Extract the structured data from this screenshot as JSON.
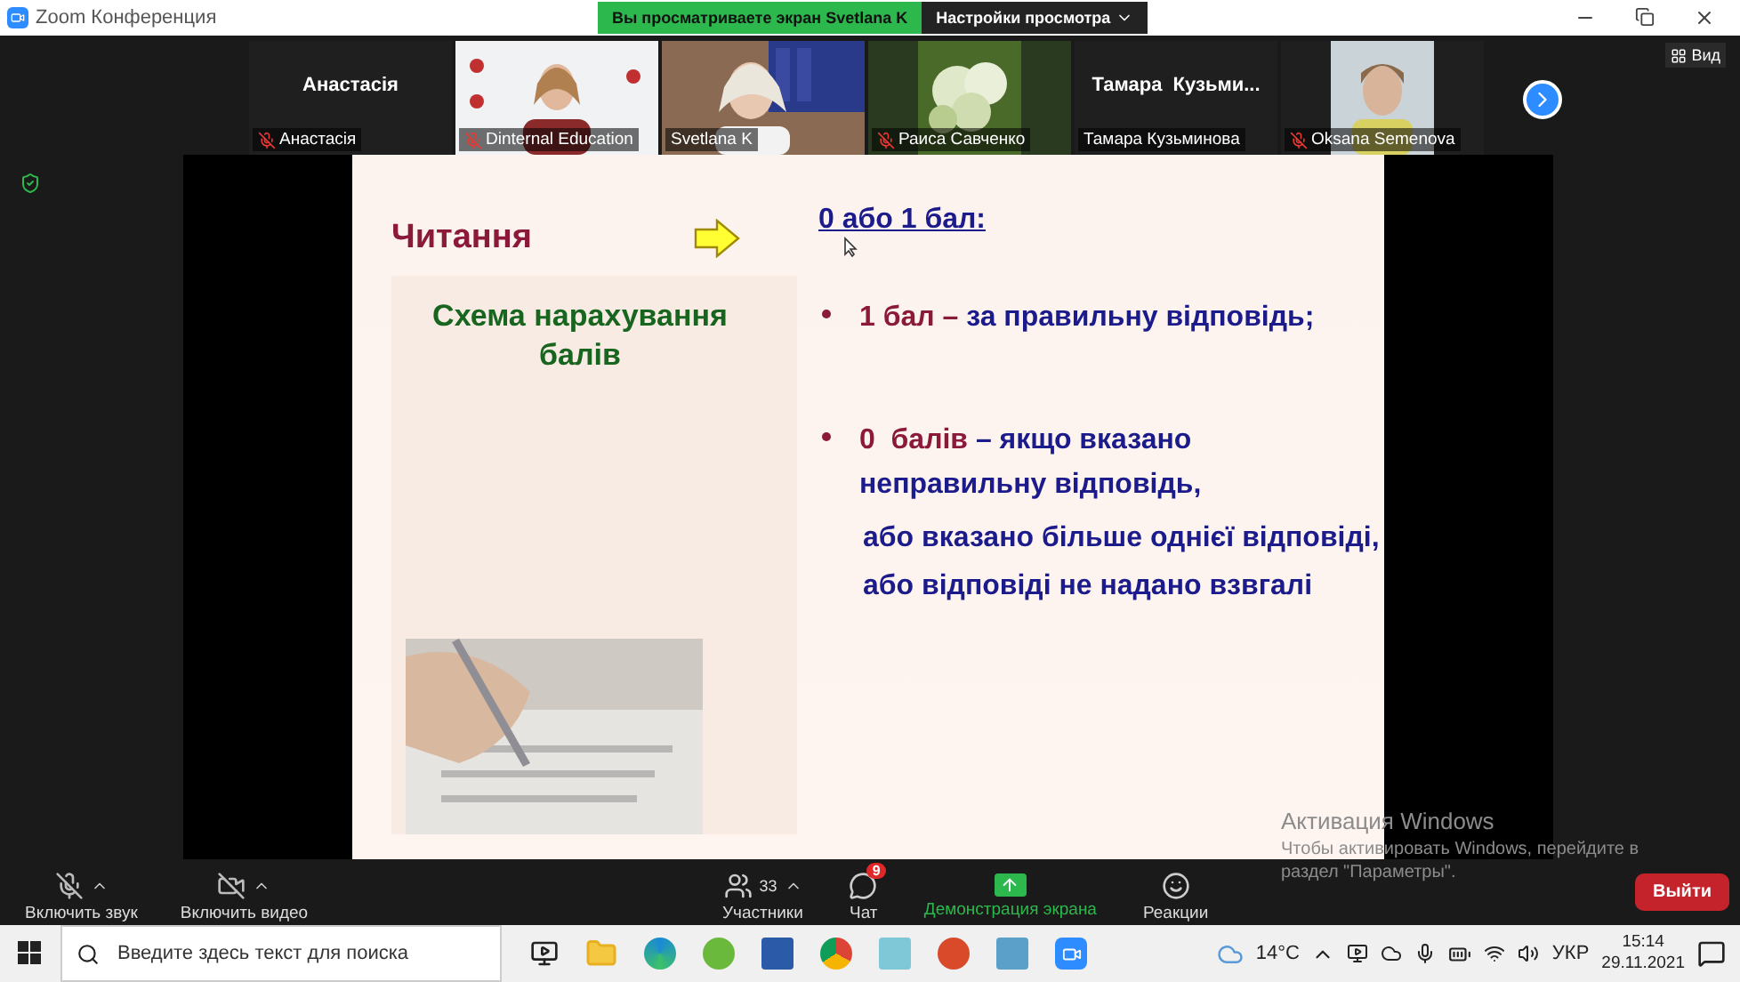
{
  "window": {
    "title": "Zoom Конференция"
  },
  "share_banner": {
    "text": "Вы просматриваете экран Svetlana K",
    "view_options": "Настройки просмотра"
  },
  "participants": [
    {
      "kind": "name",
      "display": "Анастасія",
      "caption": "Анастасія",
      "muted": true,
      "active": false
    },
    {
      "kind": "video",
      "caption": "Dinternal Education",
      "muted": true,
      "active": false
    },
    {
      "kind": "video",
      "caption": "Svetlana K",
      "muted": false,
      "active": true
    },
    {
      "kind": "video",
      "caption": "Раиса Савченко",
      "muted": true,
      "active": false
    },
    {
      "kind": "name",
      "display": "Тамара  Кузьми...",
      "caption": "Тамара Кузьминова",
      "muted": false,
      "active": false
    },
    {
      "kind": "video",
      "caption": "Oksana Semenova",
      "muted": true,
      "active": false
    }
  ],
  "view_button": "Вид",
  "slide": {
    "section": "Читання",
    "scheme": "Схема нарахування балів",
    "heading": "0 або 1 бал:",
    "bullets": [
      {
        "segments": [
          {
            "text": "1 бал",
            "color": "#8b1a3a"
          },
          {
            "text": " – ",
            "color": "#8b1a3a"
          },
          {
            "text": "за правильну відповідь;",
            "color": "#1b1b8c"
          }
        ]
      },
      {
        "segments": [
          {
            "text": "0  балів",
            "color": "#8b1a3a"
          },
          {
            "text": " – якщо вказано неправильну відповідь,",
            "color": "#1b1b8c"
          }
        ]
      }
    ],
    "continuations": [
      "або вказано більше однієї відповіді,",
      "або відповіді не надано взвгалі"
    ]
  },
  "activation_notice": {
    "title": "Активация Windows",
    "text": "Чтобы активировать Windows, перейдите в раздел \"Параметры\"."
  },
  "toolbar": {
    "items": [
      {
        "kind": "mic",
        "label": "Включить звук",
        "caret": true
      },
      {
        "kind": "video",
        "label": "Включить видео",
        "caret": true
      },
      {
        "kind": "participants",
        "label": "Участники",
        "count": "33",
        "caret": true
      },
      {
        "kind": "chat",
        "label": "Чат",
        "badge": "9",
        "caret": false
      },
      {
        "kind": "share",
        "label": "Демонстрация экрана",
        "caret": false
      },
      {
        "kind": "reactions",
        "label": "Реакции",
        "caret": false
      }
    ],
    "leave": "Выйти"
  },
  "taskbar": {
    "search_placeholder": "Введите здесь текст для поиска",
    "weather": "14°C",
    "language": "УКР",
    "time": "15:14",
    "date": "29.11.2021"
  }
}
